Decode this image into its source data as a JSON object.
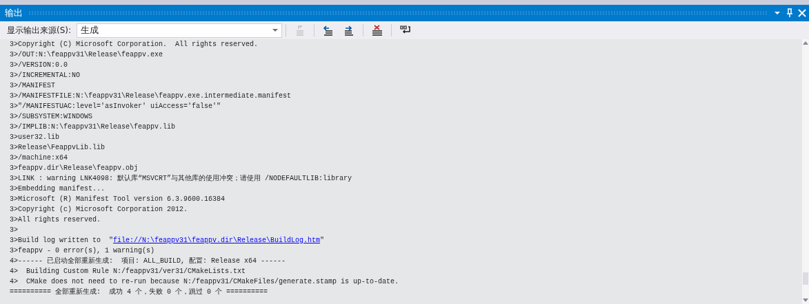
{
  "window": {
    "title": "输出"
  },
  "toolbar": {
    "source_label": "显示输出来源(S):",
    "source_value": "生成",
    "buttons": [
      {
        "kind": "goto-code",
        "disabled": true
      },
      {
        "kind": "previous",
        "disabled": false
      },
      {
        "kind": "next",
        "disabled": false
      },
      {
        "kind": "clear",
        "disabled": false
      },
      {
        "kind": "wrap",
        "disabled": false
      }
    ]
  },
  "log": {
    "lines": [
      {
        "text": "3>Copyright (C) Microsoft Corporation.  All rights reserved."
      },
      {
        "text": "3>/OUT:N:\\feappv31\\Release\\feappv.exe"
      },
      {
        "text": "3>/VERSION:0.0"
      },
      {
        "text": "3>/INCREMENTAL:NO"
      },
      {
        "text": "3>/MANIFEST"
      },
      {
        "text": "3>/MANIFESTFILE:N:\\feappv31\\Release\\feappv.exe.intermediate.manifest"
      },
      {
        "text": "3>\"/MANIFESTUAC:level='asInvoker' uiAccess='false'\""
      },
      {
        "text": "3>/SUBSYSTEM:WINDOWS"
      },
      {
        "text": "3>/IMPLIB:N:\\feappv31\\Release\\feappv.lib"
      },
      {
        "text": "3>user32.lib"
      },
      {
        "text": "3>Release\\FeappvLib.lib"
      },
      {
        "text": "3>/machine:x64"
      },
      {
        "text": "3>feappv.dir\\Release\\feappv.obj"
      },
      {
        "text": "3>LINK : warning LNK4098: 默认库“MSVCRT”与其他库的使用冲突；请使用 /NODEFAULTLIB:library"
      },
      {
        "text": "3>Embedding manifest..."
      },
      {
        "text": "3>Microsoft (R) Manifest Tool version 6.3.9600.16384"
      },
      {
        "text": "3>Copyright (c) Microsoft Corporation 2012."
      },
      {
        "text": "3>All rights reserved."
      },
      {
        "text": "3>"
      },
      {
        "text": "3>Build log written to  \"",
        "link": "file://N:\\feappv31\\feappv.dir\\Release\\BuildLog.htm",
        "after": "\""
      },
      {
        "text": "3>feappv - 0 error(s), 1 warning(s)"
      },
      {
        "text": "4>------ 已启动全部重新生成:  项目: ALL_BUILD, 配置: Release x64 ------"
      },
      {
        "text": "4>  Building Custom Rule N:/feappv31/ver31/CMakeLists.txt"
      },
      {
        "text": "4>  CMake does not need to re-run because N:/feappv31/CMakeFiles/generate.stamp is up-to-date."
      },
      {
        "text": "========== 全部重新生成:  成功 4 个，失败 0 个，跳过 0 个 =========="
      }
    ]
  }
}
